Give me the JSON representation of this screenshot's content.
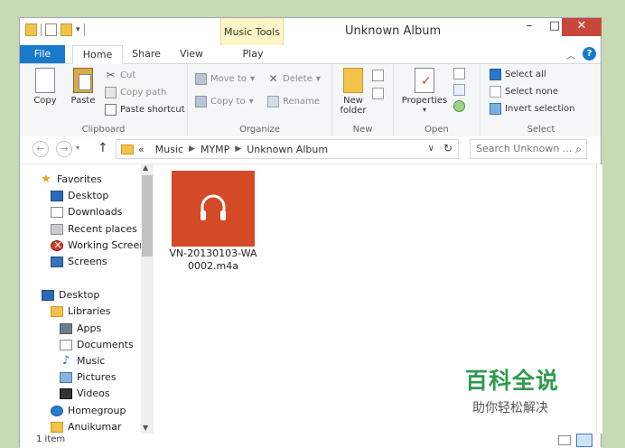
{
  "window": {
    "title": "Unknown Album",
    "context_tab": "Music Tools"
  },
  "tabs": [
    "File",
    "Home",
    "Share",
    "View",
    "Play"
  ],
  "ribbon": {
    "clipboard": {
      "label": "Clipboard",
      "copy": "Copy",
      "paste": "Paste",
      "cut": "Cut",
      "copy_path": "Copy path",
      "paste_shortcut": "Paste shortcut"
    },
    "organize": {
      "label": "Organize",
      "move_to": "Move to",
      "copy_to": "Copy to",
      "delete": "Delete",
      "rename": "Rename"
    },
    "new": {
      "label": "New",
      "new_folder_line1": "New",
      "new_folder_line2": "folder"
    },
    "open": {
      "label": "Open",
      "properties": "Properties"
    },
    "select": {
      "label": "Select",
      "select_all": "Select all",
      "select_none": "Select none",
      "invert": "Invert selection"
    }
  },
  "address": {
    "prefix": "«",
    "crumbs": [
      "Music",
      "MYMP",
      "Unknown Album"
    ],
    "search_placeholder": "Search Unknown ..."
  },
  "nav": {
    "favorites": {
      "label": "Favorites",
      "items": [
        "Desktop",
        "Downloads",
        "Recent places",
        "Working Screens",
        "Screens"
      ]
    },
    "desktop": {
      "label": "Desktop",
      "libraries": "Libraries",
      "lib_items": [
        "Apps",
        "Documents",
        "Music",
        "Pictures",
        "Videos"
      ],
      "homegroup": "Homegroup",
      "user": "Anuikumar"
    }
  },
  "files": [
    {
      "name_line1": "VN-20130103-WA",
      "name_line2": "0002.m4a"
    }
  ],
  "status": {
    "count": "1 item"
  },
  "watermark": {
    "main": "百科全说",
    "sub": "助你轻松解决"
  },
  "colors": {
    "accent": "#1979ca",
    "tile": "#d34a26",
    "context_tab": "#fdf7c5",
    "close": "#c7473b",
    "watermark": "#2f9a4d"
  }
}
